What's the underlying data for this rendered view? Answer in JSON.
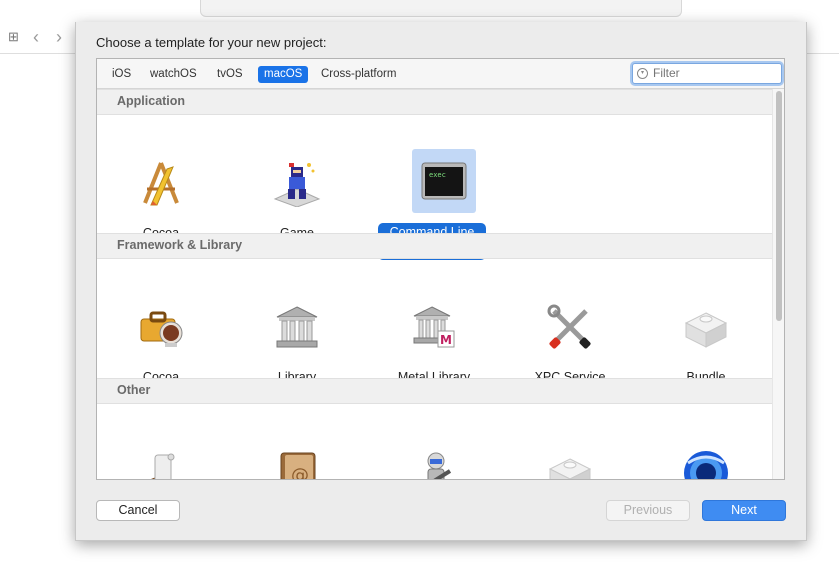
{
  "dialog": {
    "prompt": "Choose a template for your new project:"
  },
  "platform_tabs": [
    {
      "label": "iOS",
      "active": false
    },
    {
      "label": "watchOS",
      "active": false
    },
    {
      "label": "tvOS",
      "active": false
    },
    {
      "label": "macOS",
      "active": true
    },
    {
      "label": "Cross-platform",
      "active": false
    }
  ],
  "filter": {
    "placeholder": "Filter"
  },
  "sections": {
    "application": {
      "title": "Application",
      "items": [
        {
          "label": "Cocoa",
          "icon": "cocoa-app-icon"
        },
        {
          "label": "Game",
          "icon": "game-icon"
        },
        {
          "label": "Command Line Tool",
          "icon": "terminal-exec-icon",
          "selected": true
        }
      ]
    },
    "framework": {
      "title": "Framework & Library",
      "items": [
        {
          "label": "Cocoa",
          "icon": "cocoa-framework-icon"
        },
        {
          "label": "Library",
          "icon": "library-building-icon"
        },
        {
          "label": "Metal Library",
          "icon": "metal-library-icon"
        },
        {
          "label": "XPC Service",
          "icon": "xpc-tools-icon"
        },
        {
          "label": "Bundle",
          "icon": "bundle-lego-icon"
        }
      ]
    },
    "other": {
      "title": "Other",
      "items": [
        {
          "label": "",
          "icon": "applescript-scroll-icon"
        },
        {
          "label": "",
          "icon": "address-book-icon"
        },
        {
          "label": "",
          "icon": "automator-robot-icon"
        },
        {
          "label": "",
          "icon": "bundle-lego-icon"
        },
        {
          "label": "",
          "icon": "quartz-composer-icon"
        }
      ]
    }
  },
  "buttons": {
    "cancel": "Cancel",
    "previous": "Previous",
    "next": "Next"
  },
  "colors": {
    "accent": "#1a6ed8",
    "next_button": "#3f8cf2",
    "selection_bg": "#c2d8f6"
  }
}
